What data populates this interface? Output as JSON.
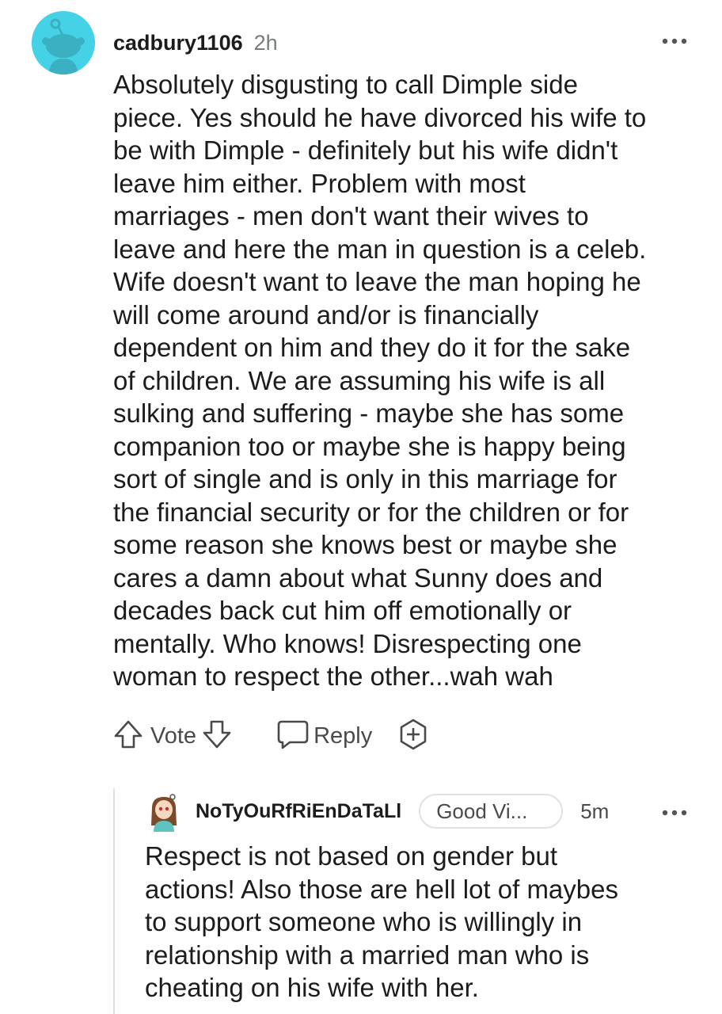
{
  "comment": {
    "username": "cadbury1106",
    "timestamp": "2h",
    "body_lines": [
      "Absolutely disgusting to call Dimple side",
      "piece. Yes should he have divorced his wife to",
      "be with Dimple - definitely but his wife didn't",
      "leave him either. Problem with most",
      "marriages - men don't want their wives to",
      "leave and here the man in question is a celeb.",
      "Wife doesn't want to leave the man hoping he",
      "will come around and/or is financially",
      "dependent on him and they do it for the sake",
      "of children. We are assuming his wife is all",
      "sulking and suffering - maybe she has some",
      "companion too or maybe she is happy being",
      "sort of single and is only in this marriage for",
      "the financial security or for the children or for",
      "some reason she knows best or maybe she",
      "cares a damn about what Sunny does and",
      "decades back cut him off emotionally or",
      "mentally. Who knows! Disrespecting one",
      "woman to respect the other...wah wah"
    ],
    "actions": {
      "vote_label": "Vote",
      "reply_label": "Reply"
    },
    "icons": [
      "upvote-icon",
      "downvote-icon",
      "reply-icon",
      "award-icon",
      "more-icon"
    ]
  },
  "reply": {
    "username": "NoTyOuRfRiEnDaTaLl",
    "flair": "Good Vi...",
    "timestamp": "5m",
    "body_lines": [
      "Respect is not based on gender but",
      "actions! Also those are hell lot of maybes",
      "to support someone who is willingly in",
      "relationship with a married man who is",
      "cheating on his wife with her."
    ]
  },
  "colors": {
    "avatar_bg": "#46d2e6",
    "text": "#1c1c1c",
    "muted": "#787c7e",
    "icon": "#4a4a4b",
    "thread_line": "#e0e0e0"
  }
}
